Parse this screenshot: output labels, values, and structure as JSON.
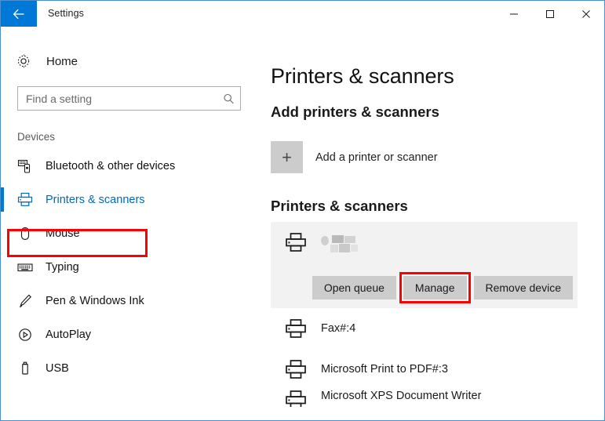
{
  "window": {
    "title": "Settings",
    "back_icon": "back-arrow-icon",
    "minimize_label": "Minimize",
    "maximize_label": "Maximize",
    "close_label": "Close",
    "accent_color": "#0078d7",
    "annotation_color": "#ff0000"
  },
  "sidebar": {
    "home": {
      "label": "Home",
      "icon": "gear-icon"
    },
    "search": {
      "placeholder": "Find a setting",
      "value": "",
      "icon": "search-icon"
    },
    "group_header": "Devices",
    "items": [
      {
        "label": "Bluetooth & other devices",
        "icon": "bluetooth-devices-icon",
        "selected": false
      },
      {
        "label": "Printers & scanners",
        "icon": "printer-icon",
        "selected": true
      },
      {
        "label": "Mouse",
        "icon": "mouse-icon",
        "selected": false
      },
      {
        "label": "Typing",
        "icon": "keyboard-icon",
        "selected": false
      },
      {
        "label": "Pen & Windows Ink",
        "icon": "pen-icon",
        "selected": false
      },
      {
        "label": "AutoPlay",
        "icon": "autoplay-icon",
        "selected": false
      },
      {
        "label": "USB",
        "icon": "usb-icon",
        "selected": false
      }
    ]
  },
  "main": {
    "page_title": "Printers & scanners",
    "add_section": {
      "title": "Add printers & scanners",
      "button_label": "Add a printer or scanner",
      "button_icon": "plus-icon"
    },
    "printers_section": {
      "title": "Printers & scanners",
      "selected_printer": {
        "name": "",
        "name_redacted": true,
        "icon": "printer-icon",
        "actions": [
          {
            "label": "Open queue",
            "annotated": false
          },
          {
            "label": "Manage",
            "annotated": true
          },
          {
            "label": "Remove device",
            "annotated": false
          }
        ]
      },
      "printers": [
        {
          "name": "Fax#:4",
          "icon": "printer-icon",
          "clipped": false
        },
        {
          "name": "Microsoft Print to PDF#:3",
          "icon": "printer-icon",
          "clipped": false
        },
        {
          "name": "Microsoft XPS Document Writer",
          "icon": "printer-icon",
          "clipped": true
        }
      ]
    }
  }
}
